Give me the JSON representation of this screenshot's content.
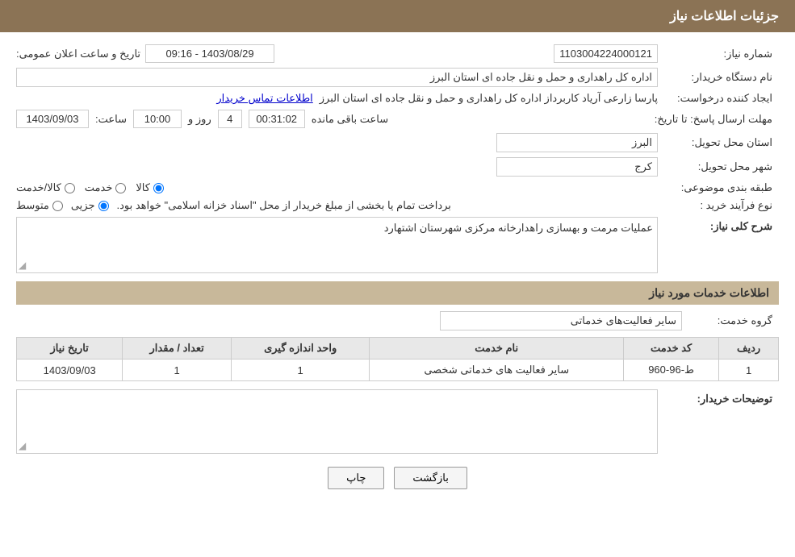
{
  "header": {
    "title": "جزئیات اطلاعات نیاز"
  },
  "fields": {
    "request_number_label": "شماره نیاز:",
    "request_number_value": "1103004224000121",
    "buyer_org_label": "نام دستگاه خریدار:",
    "buyer_org_value": "اداره کل راهداری و حمل و نقل جاده ای استان البرز",
    "requester_label": "ایجاد کننده درخواست:",
    "requester_value": "پارسا زارعی آریاد کاربرداز اداره کل راهداری و حمل و نقل جاده ای استان البرز",
    "requester_link": "اطلاعات تماس خریدار",
    "deadline_label": "مهلت ارسال پاسخ: تا تاریخ:",
    "deadline_date": "1403/09/03",
    "deadline_time_label": "ساعت:",
    "deadline_time": "10:00",
    "deadline_days_label": "روز و",
    "deadline_days": "4",
    "deadline_remaining_label": "ساعت باقی مانده",
    "deadline_remaining": "00:31:02",
    "province_label": "استان محل تحویل:",
    "province_value": "البرز",
    "city_label": "شهر محل تحویل:",
    "city_value": "کرج",
    "category_label": "طبقه بندی موضوعی:",
    "category_options": [
      "کالا",
      "خدمت",
      "کالا/خدمت"
    ],
    "category_selected": "کالا",
    "purchase_type_label": "نوع فرآیند خرید :",
    "purchase_type_text": "برداخت تمام یا بخشی از مبلغ خریدار از محل \"اسناد خزانه اسلامی\" خواهد بود.",
    "purchase_options": [
      "جزیی",
      "متوسط"
    ],
    "purchase_selected": "جزیی",
    "description_label": "شرح کلی نیاز:",
    "description_value": "عملیات مرمت و بهسازی راهدارخانه مرکزی شهرستان اشتهارد",
    "services_header": "اطلاعات خدمات مورد نیاز",
    "service_group_label": "گروه خدمت:",
    "service_group_value": "سایر فعالیت‌های خدماتی",
    "table_headers": [
      "ردیف",
      "کد خدمت",
      "نام خدمت",
      "واحد اندازه گیری",
      "تعداد / مقدار",
      "تاریخ نیاز"
    ],
    "table_rows": [
      {
        "row": "1",
        "code": "ط-96-960",
        "name": "سایر فعالیت های خدماتی شخصی",
        "unit": "1",
        "qty": "1",
        "date": "1403/09/03"
      }
    ],
    "buyer_notes_label": "توضیحات خریدار:",
    "buyer_notes_value": "",
    "public_announce_label": "تاریخ و ساعت اعلان عمومی:",
    "public_announce_value": "1403/08/29 - 09:16",
    "back_button": "بازگشت",
    "print_button": "چاپ"
  }
}
